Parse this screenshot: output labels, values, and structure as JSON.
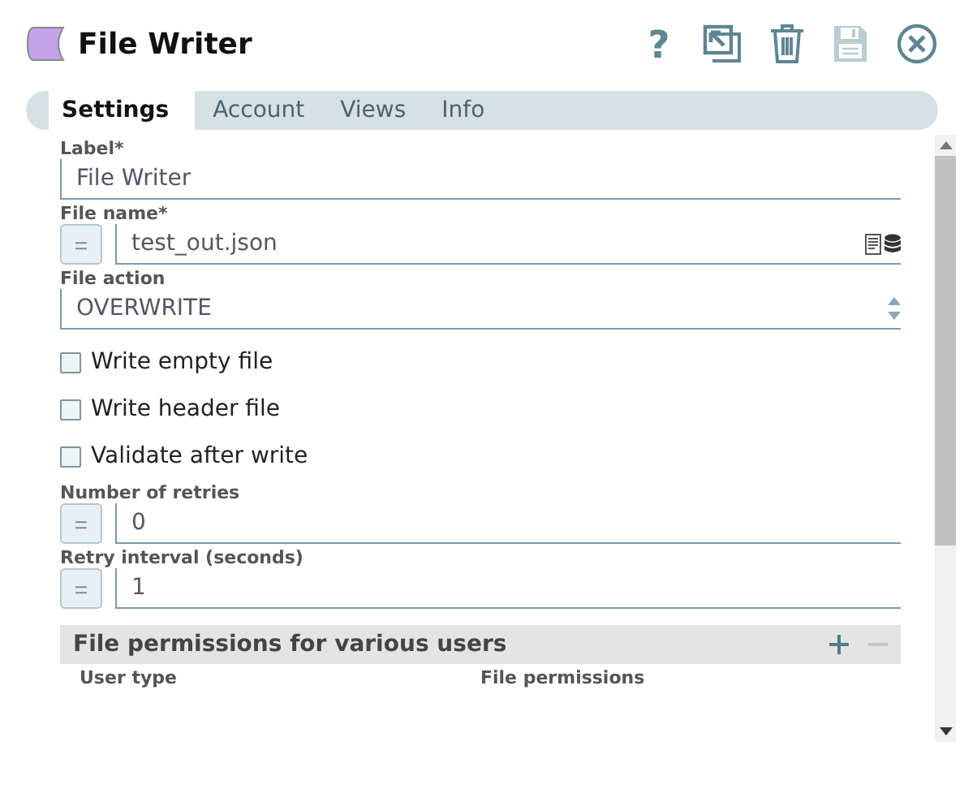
{
  "window": {
    "title": "File Writer"
  },
  "toolbar": [
    {
      "kind": "help",
      "glyph": "?",
      "disabled": false
    },
    {
      "kind": "export",
      "disabled": false
    },
    {
      "kind": "delete",
      "disabled": false
    },
    {
      "kind": "save",
      "disabled": true
    },
    {
      "kind": "close",
      "disabled": false
    }
  ],
  "tabs": [
    {
      "label": "Settings",
      "selected": true
    },
    {
      "label": "Account",
      "selected": false
    },
    {
      "label": "Views",
      "selected": false
    },
    {
      "label": "Info",
      "selected": false
    }
  ],
  "fields": [
    {
      "kind": "text",
      "label": "Label*",
      "value": "File Writer"
    },
    {
      "kind": "file",
      "label": "File name*",
      "toggle": "=",
      "value": "test_out.json"
    },
    {
      "kind": "dropdown",
      "label": "File action",
      "value": "OVERWRITE"
    },
    {
      "kind": "checkbox",
      "label": "Write empty file",
      "checked": false
    },
    {
      "kind": "checkbox",
      "label": "Write header file",
      "checked": false
    },
    {
      "kind": "checkbox",
      "label": "Validate after write",
      "checked": false
    },
    {
      "kind": "expression",
      "label": "Number of retries",
      "toggle": "=",
      "value": "0"
    },
    {
      "kind": "expression",
      "label": "Retry interval (seconds)",
      "toggle": "=",
      "value": "1"
    }
  ],
  "permissions": {
    "title": "File permissions for various users",
    "columns": [
      "User type",
      "File permissions"
    ]
  }
}
